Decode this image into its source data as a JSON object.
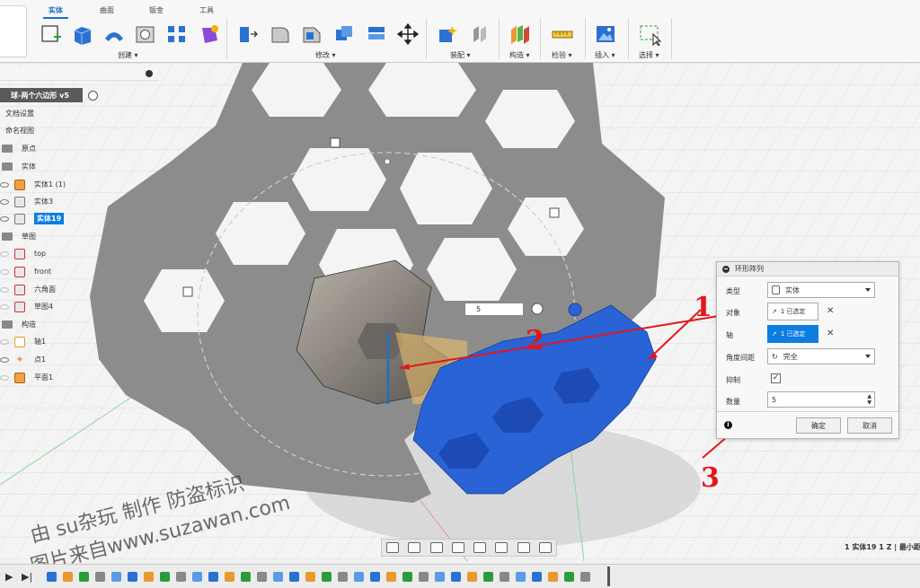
{
  "toolbar": {
    "tabs": [
      "实体",
      "曲面",
      "钣金",
      "工具"
    ],
    "active_tab": "实体",
    "groups": [
      "创建 ▾",
      "修改 ▾",
      "装配 ▾",
      "构造 ▾",
      "检验 ▾",
      "插入 ▾",
      "选择 ▾"
    ]
  },
  "browser": {
    "document_title": "球-两个六边形 v5",
    "items": [
      {
        "label": "文档设置"
      },
      {
        "label": "命名视图"
      },
      {
        "label": "原点"
      },
      {
        "label": "实体"
      },
      {
        "label": "实体1 (1)"
      },
      {
        "label": "实体3"
      },
      {
        "label": "实体19"
      },
      {
        "label": "草图"
      },
      {
        "label": "top"
      },
      {
        "label": "front"
      },
      {
        "label": "六角面"
      },
      {
        "label": "草图4"
      },
      {
        "label": "构造"
      },
      {
        "label": "轴1"
      },
      {
        "label": "点1"
      },
      {
        "label": "平面1"
      }
    ]
  },
  "dialog": {
    "title": "环形阵列",
    "type_label": "类型",
    "type_value": "实体",
    "object_label": "对象",
    "object_value": "1 已选定",
    "axis_label": "轴",
    "axis_value": "1 已选定",
    "spacing_label": "角度间距",
    "spacing_value": "完全",
    "suppress_label": "抑制",
    "count_label": "数量",
    "count_value": "5",
    "ok_label": "确定",
    "cancel_label": "取消"
  },
  "viewport": {
    "inline_count": "5"
  },
  "annotations": [
    "1",
    "2",
    "3"
  ],
  "watermark": {
    "line1": "由 su杂玩 制作 防盗标识",
    "line2": "图片来自www.suzawan.com"
  },
  "status_text": "1 实体19 1 Z | 最小距",
  "colors": {
    "accent": "#0d7de0",
    "pattern_blue": "#2a63d6",
    "annotation_red": "#e3161d"
  }
}
